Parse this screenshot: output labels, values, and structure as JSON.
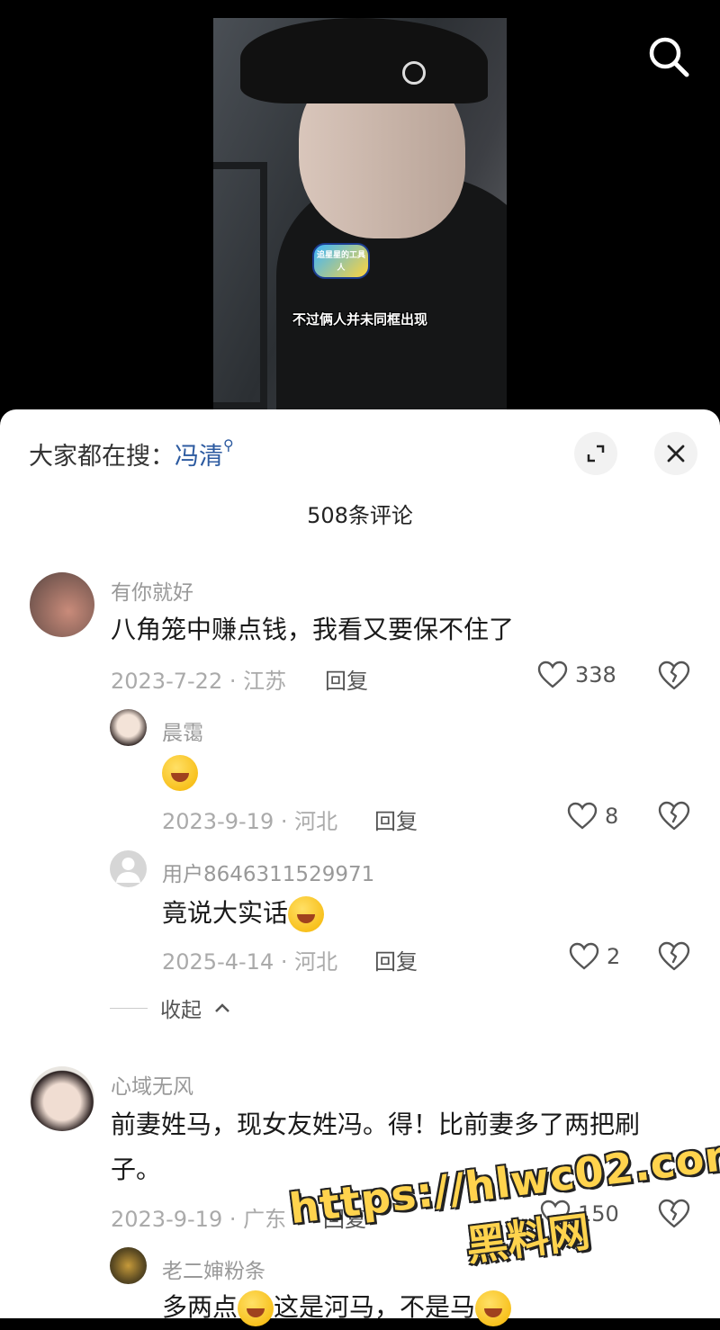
{
  "video": {
    "subtitle": "不过俩人并未同框出现",
    "sticker_text": "追星星的工具人"
  },
  "panel": {
    "hot_search_prefix": "大家都在搜：",
    "hot_search_keyword": "冯清",
    "comment_count_label": "508条评论"
  },
  "comments": [
    {
      "user": "有你就好",
      "text": "八角笼中赚点钱，我看又要保不住了",
      "meta": "2023-7-22 · 江苏",
      "reply_label": "回复",
      "likes": "338"
    },
    {
      "user": "心域无风",
      "text_line1": "前妻姓马，现女友姓冯。得！比前妻多了两把刷",
      "text_line2": "子。",
      "meta": "2023-9-19 · 广东",
      "reply_label": "回复",
      "likes": "150"
    }
  ],
  "replies": [
    {
      "user": "晨霭",
      "text": "",
      "meta": "2023-9-19 · 河北",
      "reply_label": "回复",
      "likes": "8"
    },
    {
      "user": "用户8646311529971",
      "text": "竟说大实话",
      "meta": "2025-4-14 · 河北",
      "reply_label": "回复",
      "likes": "2"
    },
    {
      "user": "老二婶粉条",
      "text": "多两点",
      "text_b": "这是河马，不是马"
    }
  ],
  "collapse_label": "收起",
  "watermark": {
    "url": "https://hlwc02.com",
    "site": "黑料网"
  }
}
